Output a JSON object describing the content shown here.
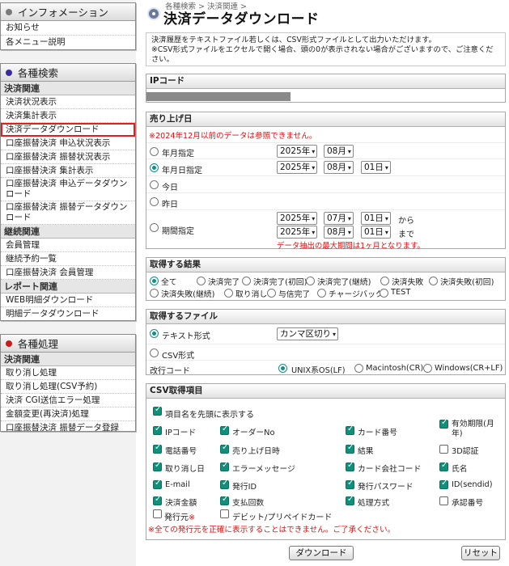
{
  "sidebar": {
    "info": {
      "title": "インフォメーション",
      "bullet_color": "#7a7a7a",
      "items": [
        "お知らせ",
        "各メニュー説明"
      ]
    },
    "search": {
      "title": "各種検索",
      "bullet_color": "#3a2aa0",
      "categories": [
        {
          "label": "決済関連",
          "items": [
            "決済状況表示",
            "決済集計表示",
            "決済データダウンロード",
            "口座振替決済 申込状況表示",
            "口座振替決済 振替状況表示",
            "口座振替決済 集計表示",
            "口座振替決済 申込データダウンロード",
            "口座振替決済 振替データダウンロード"
          ]
        },
        {
          "label": "継続関連",
          "items": [
            "会員管理",
            "継続予約一覧",
            "口座振替決済 会員管理"
          ]
        },
        {
          "label": "レポート関連",
          "items": [
            "WEB明細ダウンロード",
            "明細データダウンロード"
          ]
        }
      ]
    },
    "process": {
      "title": "各種処理",
      "bullet_color": "#d01818",
      "categories": [
        {
          "label": "決済関連",
          "items": [
            "取り消し処理",
            "取り消し処理(CSV予約)",
            "決済 CGI送信エラー処理",
            "金額変更(再決済)処理",
            "口座振替決済 振替データ登録"
          ]
        }
      ]
    }
  },
  "main": {
    "breadcrumb": "各種検索 > 決済関連 >",
    "title": "決済データダウンロード",
    "intro": [
      "決済履歴をテキストファイル若しくは、CSV形式ファイルとして出力いただけます。",
      "※CSV形式ファイルをエクセルで開く場合、頭の0が表示されない場合がございますので、ご注意ください。"
    ],
    "ip_section": {
      "title": "IPコード"
    },
    "sales_section": {
      "title": "売り上げ日",
      "warning": "※2024年12月以前のデータは参照できません。",
      "options": {
        "month": "年月指定",
        "date": "年月日指定",
        "today": "今日",
        "yesterday": "昨日",
        "period": "期間指定"
      },
      "selected": "date",
      "month_sel": {
        "year": "2025年",
        "month": "08月"
      },
      "date_sel": {
        "year": "2025年",
        "month": "08月",
        "day": "01日"
      },
      "period_from": {
        "year": "2025年",
        "month": "07月",
        "day": "01日",
        "suffix": "から"
      },
      "period_to": {
        "year": "2025年",
        "month": "08月",
        "day": "01日",
        "suffix": "まで"
      },
      "period_note": "データ抽出の最大期間は1ヶ月となります。"
    },
    "result_section": {
      "title": "取得する結果",
      "options": [
        "全て",
        "決済完了",
        "決済完了(初回)",
        "決済完了(継続)",
        "決済失敗",
        "決済失敗(初回)",
        "決済失敗(継続)",
        "取り消し",
        "与信完了",
        "チャージバック",
        "TEST"
      ],
      "selected": "全て"
    },
    "file_section": {
      "title": "取得するファイル",
      "text_format": "テキスト形式",
      "delimiter": "カンマ区切り",
      "csv_format": "CSV形式",
      "newline_label": "改行コード",
      "newline_options": [
        "UNIX系OS(LF)",
        "Macintosh(CR)",
        "Windows(CR+LF)"
      ],
      "newline_selected": "UNIX系OS(LF)"
    },
    "csv_section": {
      "title": "CSV取得項目",
      "header_option": "項目名を先頭に表示する",
      "rows": [
        [
          {
            "label": "IPコード",
            "checked": true
          },
          {
            "label": "オーダーNo",
            "checked": true
          },
          {
            "label": "カード番号",
            "checked": true
          },
          {
            "label": "有効期限(月年)",
            "checked": true
          }
        ],
        [
          {
            "label": "電話番号",
            "checked": true
          },
          {
            "label": "売り上げ日時",
            "checked": true
          },
          {
            "label": "結果",
            "checked": true
          },
          {
            "label": "3D認証",
            "checked": false
          }
        ],
        [
          {
            "label": "取り消し日",
            "checked": true
          },
          {
            "label": "エラーメッセージ",
            "checked": true
          },
          {
            "label": "カード会社コード",
            "checked": true
          },
          {
            "label": "氏名",
            "checked": true
          }
        ],
        [
          {
            "label": "E-mail",
            "checked": true
          },
          {
            "label": "発行ID",
            "checked": true
          },
          {
            "label": "発行パスワード",
            "checked": true
          },
          {
            "label": "ID(sendid)",
            "checked": true
          }
        ],
        [
          {
            "label": "決済金額",
            "checked": true
          },
          {
            "label": "支払回数",
            "checked": true
          },
          {
            "label": "処理方式",
            "checked": true
          },
          {
            "label": "承認番号",
            "checked": false
          }
        ]
      ],
      "issuer_label": "発行元",
      "issuer_mark": "※",
      "debit_label": "デビット/プリペイドカード",
      "note": "※全ての発行元を正確に表示することはできません。ご了承ください。"
    },
    "buttons": {
      "download": "ダウンロード",
      "reset": "リセット"
    }
  }
}
